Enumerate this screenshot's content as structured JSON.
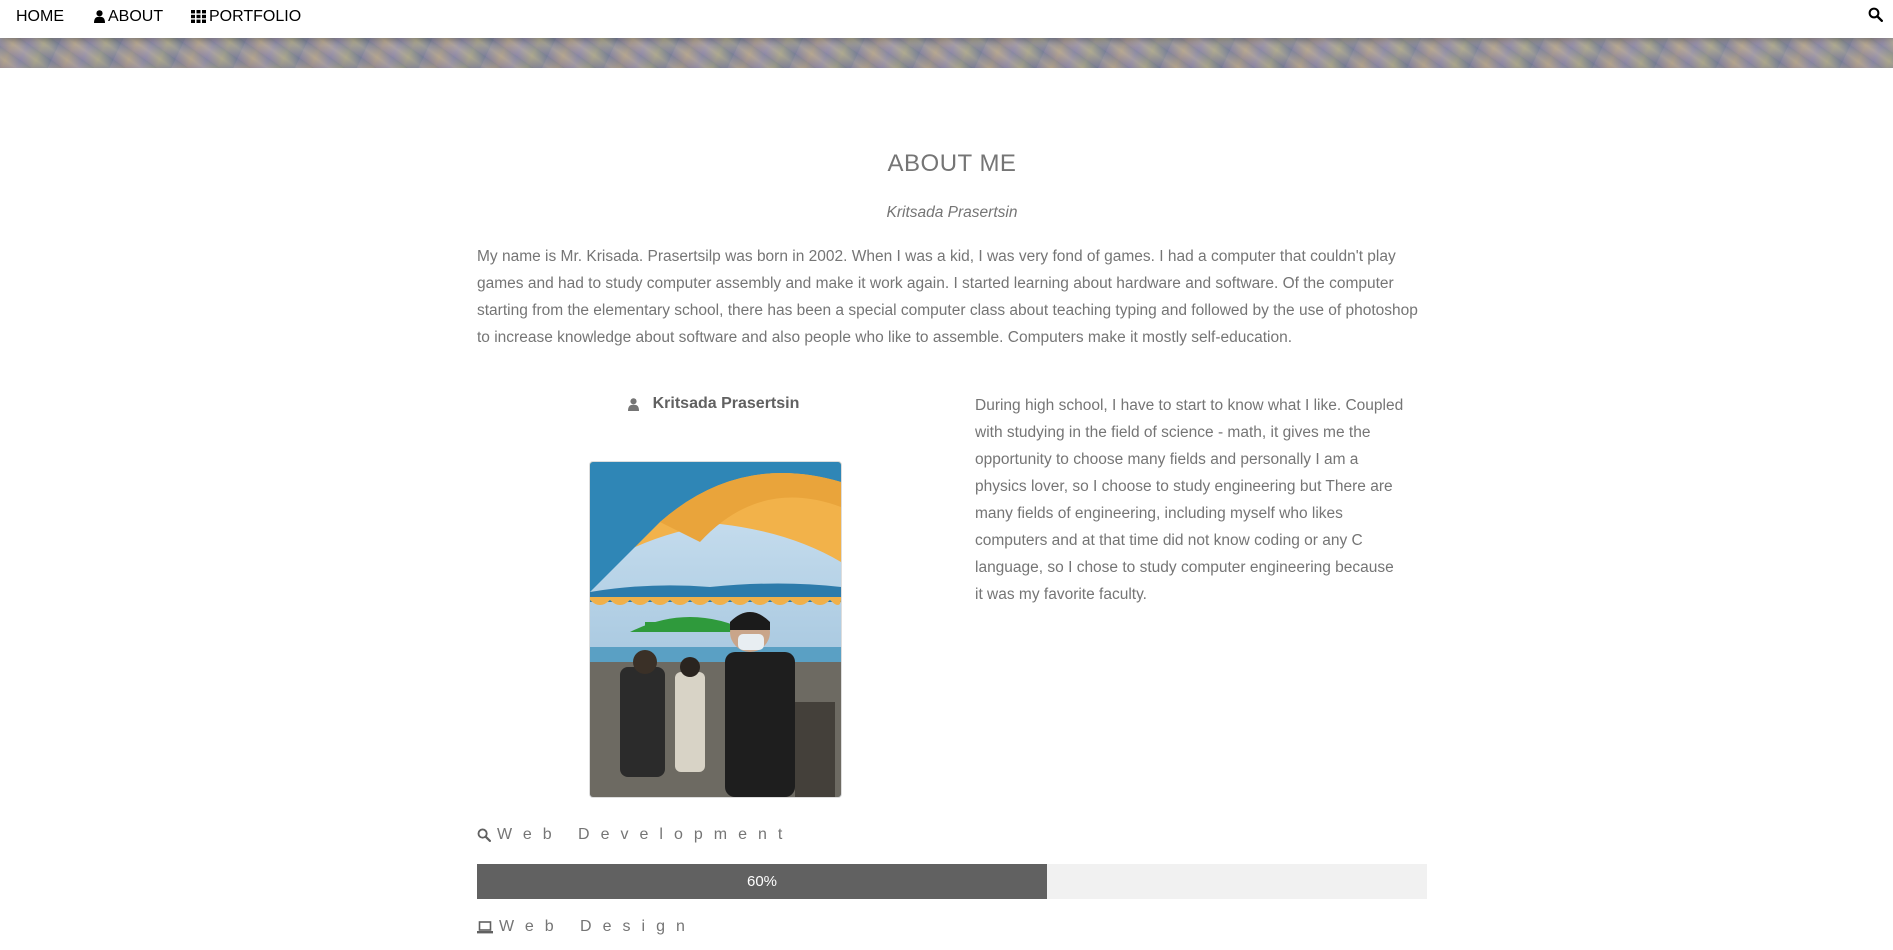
{
  "nav": {
    "home_label": "HOME",
    "about_label": "ABOUT",
    "portfolio_label": "PORTFOLIO",
    "about_icon": "user-icon",
    "portfolio_icon": "grid-icon",
    "search_icon": "search-icon"
  },
  "about": {
    "title": "ABOUT ME",
    "subtitle": "Kritsada Prasertsin",
    "intro": "My name is Mr. Krisada. Prasertsilp was born in 2002. When I was a kid, I was very fond of games. I had a computer that couldn't play games and had to study computer assembly and make it work again. I started learning about hardware and software. Of the computer starting from the elementary school, there has been a special computer class about teaching typing and followed by the use of photoshop to increase knowledge about software and also people who like to assemble. Computers make it mostly self-education.",
    "profile_name": "Kritsada Prasertsin",
    "side_text": "During high school, I have to start to know what I like. Coupled with studying in the field of science - math, it gives me the opportunity to choose many fields and personally I am a physics lover, so I choose to study engineering but There are many fields of engineering, including myself who likes computers and at that time did not know coding or any C language, so I chose to study computer engineering because it was my favorite faculty."
  },
  "skills": [
    {
      "label": "Web Development",
      "icon": "search-icon",
      "percent": 60,
      "percent_label": "60%"
    },
    {
      "label": "Web Design",
      "icon": "laptop-icon"
    }
  ],
  "colors": {
    "text": "#757575",
    "bar_fill": "#616161",
    "bar_bg": "#f1f1f1"
  }
}
